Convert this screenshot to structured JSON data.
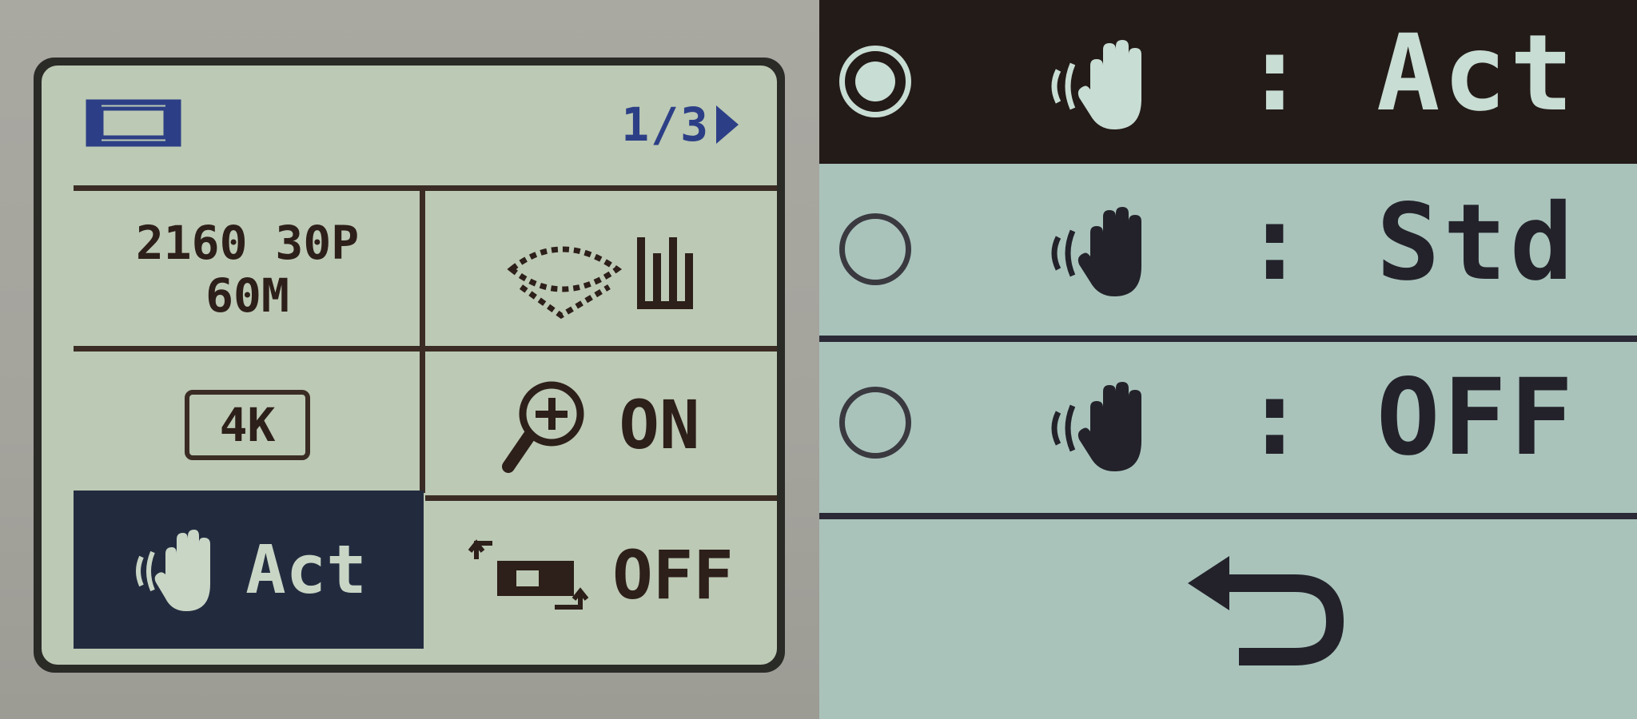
{
  "camera_screen": {
    "page_indicator": "1/3",
    "format": {
      "line1": "2160 30P",
      "line2": "60M"
    },
    "resolution_badge": "4K",
    "zoom_status": "ON",
    "stabilizer_status": "Act",
    "power_status": "OFF"
  },
  "stabilizer_menu": {
    "options": [
      {
        "label": ": Act",
        "selected": true
      },
      {
        "label": ": Std",
        "selected": false
      },
      {
        "label": ": OFF",
        "selected": false
      }
    ]
  },
  "icons": {
    "movie_mode": "film-strip-icon",
    "page_next": "right-triangle-icon",
    "autofocus": "af-area-icon",
    "zoom": "magnifier-plus-icon",
    "stabilizer": "shaking-hand-icon",
    "power": "camera-rotate-icon",
    "return": "return-arrow-icon"
  },
  "colors": {
    "lcd_background": "#bcc9b4",
    "lcd_text": "#2d1f1a",
    "lcd_accent": "#2c3f86",
    "selected_cell": "#222b3e",
    "menu_background": "#a9c3bb",
    "menu_selected": "#231b18"
  }
}
